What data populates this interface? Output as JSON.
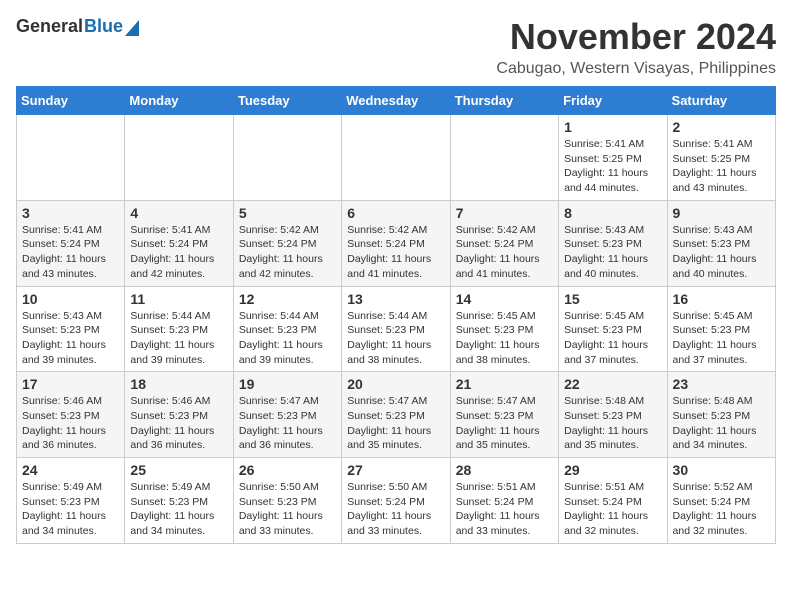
{
  "header": {
    "logo_general": "General",
    "logo_blue": "Blue",
    "month_title": "November 2024",
    "location": "Cabugao, Western Visayas, Philippines"
  },
  "calendar": {
    "headers": [
      "Sunday",
      "Monday",
      "Tuesday",
      "Wednesday",
      "Thursday",
      "Friday",
      "Saturday"
    ],
    "weeks": [
      [
        {
          "day": "",
          "info": ""
        },
        {
          "day": "",
          "info": ""
        },
        {
          "day": "",
          "info": ""
        },
        {
          "day": "",
          "info": ""
        },
        {
          "day": "",
          "info": ""
        },
        {
          "day": "1",
          "info": "Sunrise: 5:41 AM\nSunset: 5:25 PM\nDaylight: 11 hours\nand 44 minutes."
        },
        {
          "day": "2",
          "info": "Sunrise: 5:41 AM\nSunset: 5:25 PM\nDaylight: 11 hours\nand 43 minutes."
        }
      ],
      [
        {
          "day": "3",
          "info": "Sunrise: 5:41 AM\nSunset: 5:24 PM\nDaylight: 11 hours\nand 43 minutes."
        },
        {
          "day": "4",
          "info": "Sunrise: 5:41 AM\nSunset: 5:24 PM\nDaylight: 11 hours\nand 42 minutes."
        },
        {
          "day": "5",
          "info": "Sunrise: 5:42 AM\nSunset: 5:24 PM\nDaylight: 11 hours\nand 42 minutes."
        },
        {
          "day": "6",
          "info": "Sunrise: 5:42 AM\nSunset: 5:24 PM\nDaylight: 11 hours\nand 41 minutes."
        },
        {
          "day": "7",
          "info": "Sunrise: 5:42 AM\nSunset: 5:24 PM\nDaylight: 11 hours\nand 41 minutes."
        },
        {
          "day": "8",
          "info": "Sunrise: 5:43 AM\nSunset: 5:23 PM\nDaylight: 11 hours\nand 40 minutes."
        },
        {
          "day": "9",
          "info": "Sunrise: 5:43 AM\nSunset: 5:23 PM\nDaylight: 11 hours\nand 40 minutes."
        }
      ],
      [
        {
          "day": "10",
          "info": "Sunrise: 5:43 AM\nSunset: 5:23 PM\nDaylight: 11 hours\nand 39 minutes."
        },
        {
          "day": "11",
          "info": "Sunrise: 5:44 AM\nSunset: 5:23 PM\nDaylight: 11 hours\nand 39 minutes."
        },
        {
          "day": "12",
          "info": "Sunrise: 5:44 AM\nSunset: 5:23 PM\nDaylight: 11 hours\nand 39 minutes."
        },
        {
          "day": "13",
          "info": "Sunrise: 5:44 AM\nSunset: 5:23 PM\nDaylight: 11 hours\nand 38 minutes."
        },
        {
          "day": "14",
          "info": "Sunrise: 5:45 AM\nSunset: 5:23 PM\nDaylight: 11 hours\nand 38 minutes."
        },
        {
          "day": "15",
          "info": "Sunrise: 5:45 AM\nSunset: 5:23 PM\nDaylight: 11 hours\nand 37 minutes."
        },
        {
          "day": "16",
          "info": "Sunrise: 5:45 AM\nSunset: 5:23 PM\nDaylight: 11 hours\nand 37 minutes."
        }
      ],
      [
        {
          "day": "17",
          "info": "Sunrise: 5:46 AM\nSunset: 5:23 PM\nDaylight: 11 hours\nand 36 minutes."
        },
        {
          "day": "18",
          "info": "Sunrise: 5:46 AM\nSunset: 5:23 PM\nDaylight: 11 hours\nand 36 minutes."
        },
        {
          "day": "19",
          "info": "Sunrise: 5:47 AM\nSunset: 5:23 PM\nDaylight: 11 hours\nand 36 minutes."
        },
        {
          "day": "20",
          "info": "Sunrise: 5:47 AM\nSunset: 5:23 PM\nDaylight: 11 hours\nand 35 minutes."
        },
        {
          "day": "21",
          "info": "Sunrise: 5:47 AM\nSunset: 5:23 PM\nDaylight: 11 hours\nand 35 minutes."
        },
        {
          "day": "22",
          "info": "Sunrise: 5:48 AM\nSunset: 5:23 PM\nDaylight: 11 hours\nand 35 minutes."
        },
        {
          "day": "23",
          "info": "Sunrise: 5:48 AM\nSunset: 5:23 PM\nDaylight: 11 hours\nand 34 minutes."
        }
      ],
      [
        {
          "day": "24",
          "info": "Sunrise: 5:49 AM\nSunset: 5:23 PM\nDaylight: 11 hours\nand 34 minutes."
        },
        {
          "day": "25",
          "info": "Sunrise: 5:49 AM\nSunset: 5:23 PM\nDaylight: 11 hours\nand 34 minutes."
        },
        {
          "day": "26",
          "info": "Sunrise: 5:50 AM\nSunset: 5:23 PM\nDaylight: 11 hours\nand 33 minutes."
        },
        {
          "day": "27",
          "info": "Sunrise: 5:50 AM\nSunset: 5:24 PM\nDaylight: 11 hours\nand 33 minutes."
        },
        {
          "day": "28",
          "info": "Sunrise: 5:51 AM\nSunset: 5:24 PM\nDaylight: 11 hours\nand 33 minutes."
        },
        {
          "day": "29",
          "info": "Sunrise: 5:51 AM\nSunset: 5:24 PM\nDaylight: 11 hours\nand 32 minutes."
        },
        {
          "day": "30",
          "info": "Sunrise: 5:52 AM\nSunset: 5:24 PM\nDaylight: 11 hours\nand 32 minutes."
        }
      ]
    ]
  }
}
